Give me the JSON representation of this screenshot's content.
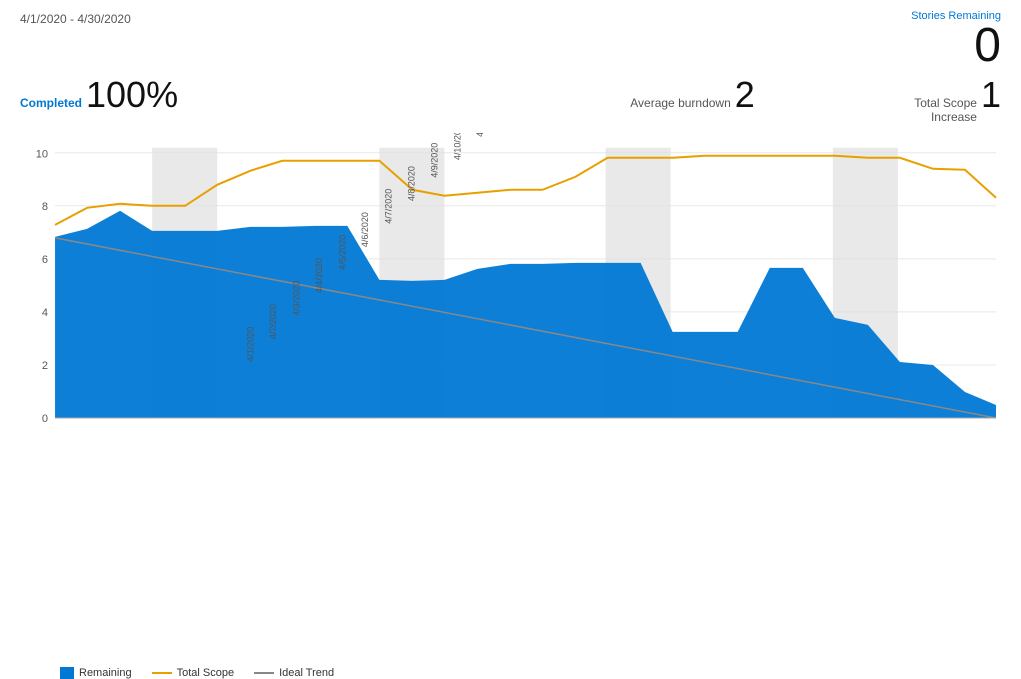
{
  "header": {
    "date_range": "4/1/2020 - 4/30/2020",
    "stories_remaining_label": "Stories Remaining",
    "stories_remaining_value": "0"
  },
  "metrics": {
    "completed_label": "Completed",
    "completed_value": "100%",
    "avg_burndown_label": "Average burndown",
    "avg_burndown_value": "2",
    "total_scope_label": "Total Scope Increase",
    "total_scope_value": "1"
  },
  "legend": {
    "remaining_label": "Remaining",
    "total_scope_label": "Total Scope",
    "ideal_trend_label": "Ideal Trend"
  },
  "chart": {
    "colors": {
      "remaining": "#0078d4",
      "total_scope": "#e8a000",
      "ideal_trend": "#888888",
      "weekend_bg": "#e0e0e0"
    }
  }
}
